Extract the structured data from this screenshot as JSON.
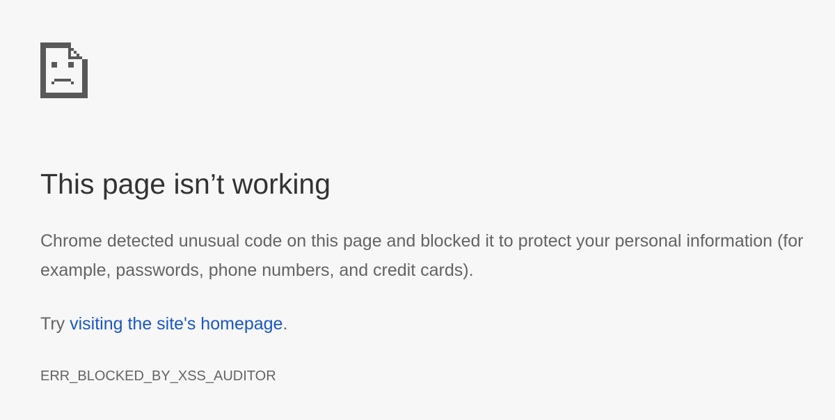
{
  "icon": "sad-page-icon",
  "title": "This page isn’t working",
  "explanation": "Chrome detected unusual code on this page and blocked it to protect your personal information (for example, passwords, phone numbers, and credit cards).",
  "suggestion": {
    "prefix": "Try ",
    "link_text": "visiting the site's homepage",
    "suffix": "."
  },
  "error_code": "ERR_BLOCKED_BY_XSS_AUDITOR",
  "colors": {
    "background": "#f7f7f7",
    "title": "#333333",
    "body_text": "#646464",
    "link": "#1a57c4"
  }
}
